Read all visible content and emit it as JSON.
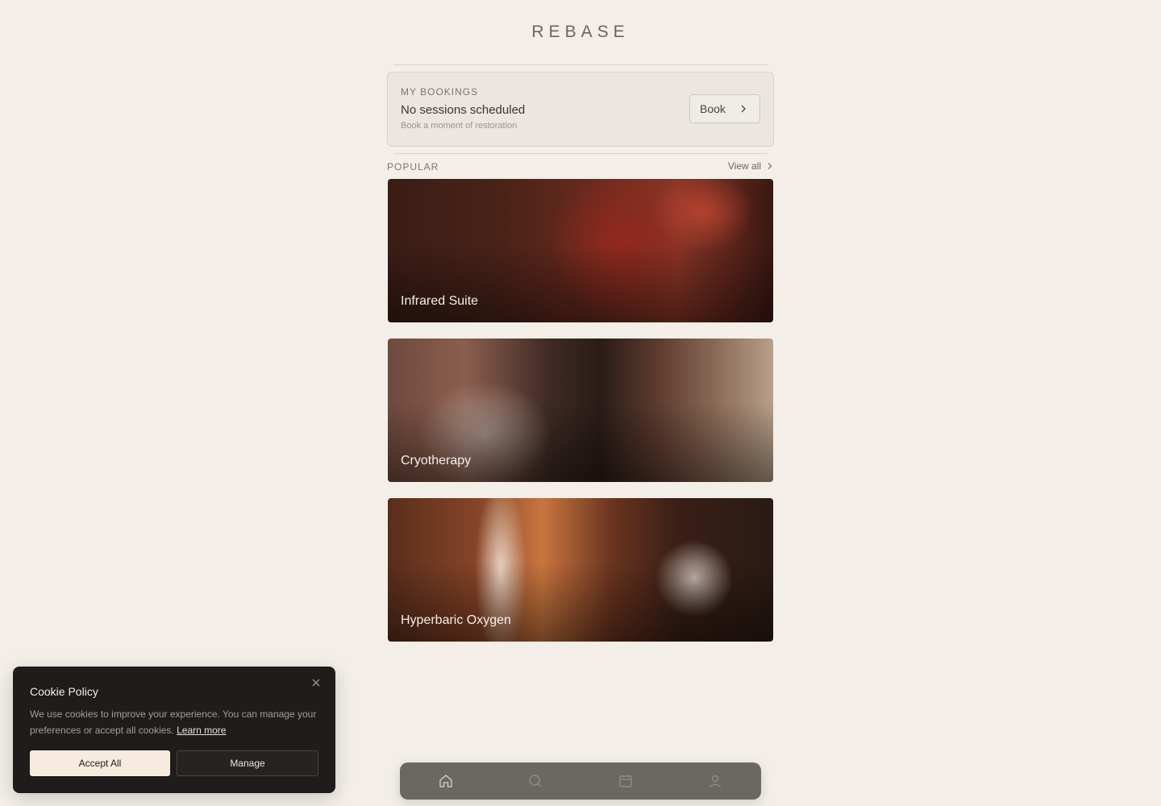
{
  "header": {
    "logo": "REBASE"
  },
  "bookings": {
    "kicker": "MY BOOKINGS",
    "title": "No sessions scheduled",
    "subtitle": "Book a moment of restoration",
    "book_label": "Book"
  },
  "popular": {
    "label": "POPULAR",
    "view_all": "View all",
    "cards": [
      {
        "name": "Infrared Suite"
      },
      {
        "name": "Cryotherapy"
      },
      {
        "name": "Hyperbaric Oxygen"
      }
    ]
  },
  "cookie": {
    "title": "Cookie Policy",
    "text": "We use cookies to improve your experience. You can manage your preferences or accept all cookies.",
    "learn_more": "Learn more",
    "accept": "Accept All",
    "manage": "Manage"
  },
  "tabbar": {
    "tabs": [
      {
        "icon": "home-icon",
        "active": true
      },
      {
        "icon": "search-icon",
        "active": false
      },
      {
        "icon": "calendar-icon",
        "active": false
      },
      {
        "icon": "user-icon",
        "active": false
      }
    ]
  },
  "colors": {
    "background": "#f3efe8",
    "cookie_bg": "#1f1d1b",
    "accept_bg": "#f7ebdf",
    "tabbar_bg": "#6b6864"
  }
}
